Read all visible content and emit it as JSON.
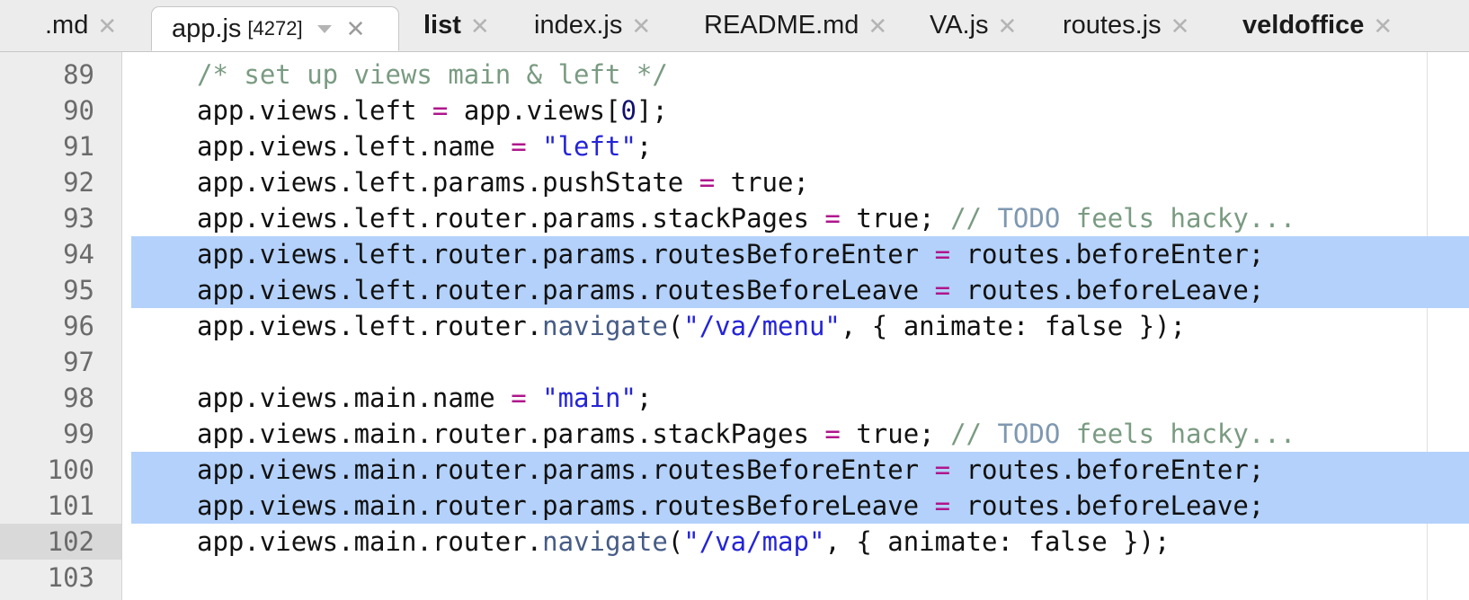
{
  "tabs": [
    {
      "label": ".md",
      "bold": false,
      "active": false,
      "close": "✕"
    },
    {
      "label": "app.js",
      "badge": "[4272]",
      "bold": false,
      "active": true,
      "close": "✕"
    },
    {
      "label": "list",
      "bold": true,
      "active": false,
      "close": "✕"
    },
    {
      "label": "index.js",
      "bold": false,
      "active": false,
      "close": "✕"
    },
    {
      "label": "README.md",
      "bold": false,
      "active": false,
      "close": "✕"
    },
    {
      "label": "VA.js",
      "bold": false,
      "active": false,
      "close": "✕"
    },
    {
      "label": "routes.js",
      "bold": false,
      "active": false,
      "close": "✕"
    },
    {
      "label": "veldoffice",
      "bold": true,
      "active": false,
      "close": "✕"
    }
  ],
  "editor": {
    "current_line": 102,
    "selected_lines": [
      94,
      95,
      100,
      101
    ],
    "colors": {
      "comment": "#7a9b82",
      "todo": "#7f98b1",
      "string": "#2424d8",
      "operator": "#b0158c",
      "number": "#11116e",
      "function": "#465c86",
      "selection": "#b3d1fa"
    },
    "lines": [
      {
        "num": "89",
        "tokens": [
          {
            "t": "comment",
            "v": "/* set up views main & left */"
          }
        ]
      },
      {
        "num": "90",
        "tokens": [
          {
            "t": "plain",
            "v": "app.views.left "
          },
          {
            "t": "op",
            "v": "="
          },
          {
            "t": "plain",
            "v": " app.views["
          },
          {
            "t": "number",
            "v": "0"
          },
          {
            "t": "plain",
            "v": "];"
          }
        ]
      },
      {
        "num": "91",
        "tokens": [
          {
            "t": "plain",
            "v": "app.views.left.name "
          },
          {
            "t": "op",
            "v": "="
          },
          {
            "t": "plain",
            "v": " "
          },
          {
            "t": "string",
            "v": "\"left\""
          },
          {
            "t": "plain",
            "v": ";"
          }
        ]
      },
      {
        "num": "92",
        "tokens": [
          {
            "t": "plain",
            "v": "app.views.left.params.pushState "
          },
          {
            "t": "op",
            "v": "="
          },
          {
            "t": "plain",
            "v": " true;"
          }
        ]
      },
      {
        "num": "93",
        "tokens": [
          {
            "t": "plain",
            "v": "app.views.left.router.params.stackPages "
          },
          {
            "t": "op",
            "v": "="
          },
          {
            "t": "plain",
            "v": " true; "
          },
          {
            "t": "comment",
            "v": "// "
          },
          {
            "t": "todo",
            "v": "TODO"
          },
          {
            "t": "comment",
            "v": " feels hacky..."
          }
        ]
      },
      {
        "num": "94",
        "tokens": [
          {
            "t": "plain",
            "v": "app.views.left.router.params.routesBeforeEnter "
          },
          {
            "t": "op",
            "v": "="
          },
          {
            "t": "plain",
            "v": " routes.beforeEnter;"
          }
        ]
      },
      {
        "num": "95",
        "tokens": [
          {
            "t": "plain",
            "v": "app.views.left.router.params.routesBeforeLeave "
          },
          {
            "t": "op",
            "v": "="
          },
          {
            "t": "plain",
            "v": " routes.beforeLeave;"
          }
        ]
      },
      {
        "num": "96",
        "tokens": [
          {
            "t": "plain",
            "v": "app.views.left.router."
          },
          {
            "t": "fn",
            "v": "navigate"
          },
          {
            "t": "plain",
            "v": "("
          },
          {
            "t": "string",
            "v": "\"/va/menu\""
          },
          {
            "t": "plain",
            "v": ", { animate: false });"
          }
        ]
      },
      {
        "num": "97",
        "tokens": []
      },
      {
        "num": "98",
        "tokens": [
          {
            "t": "plain",
            "v": "app.views.main.name "
          },
          {
            "t": "op",
            "v": "="
          },
          {
            "t": "plain",
            "v": " "
          },
          {
            "t": "string",
            "v": "\"main\""
          },
          {
            "t": "plain",
            "v": ";"
          }
        ]
      },
      {
        "num": "99",
        "tokens": [
          {
            "t": "plain",
            "v": "app.views.main.router.params.stackPages "
          },
          {
            "t": "op",
            "v": "="
          },
          {
            "t": "plain",
            "v": " true; "
          },
          {
            "t": "comment",
            "v": "// "
          },
          {
            "t": "todo",
            "v": "TODO"
          },
          {
            "t": "comment",
            "v": " feels hacky..."
          }
        ]
      },
      {
        "num": "100",
        "tokens": [
          {
            "t": "plain",
            "v": "app.views.main.router.params.routesBeforeEnter "
          },
          {
            "t": "op",
            "v": "="
          },
          {
            "t": "plain",
            "v": " routes.beforeEnter;"
          }
        ]
      },
      {
        "num": "101",
        "tokens": [
          {
            "t": "plain",
            "v": "app.views.main.router.params.routesBeforeLeave "
          },
          {
            "t": "op",
            "v": "="
          },
          {
            "t": "plain",
            "v": " routes.beforeLeave;"
          }
        ]
      },
      {
        "num": "102",
        "tokens": [
          {
            "t": "plain",
            "v": "app.views.main.router."
          },
          {
            "t": "fn",
            "v": "navigate"
          },
          {
            "t": "plain",
            "v": "("
          },
          {
            "t": "string",
            "v": "\"/va/map\""
          },
          {
            "t": "plain",
            "v": ", { animate: false });"
          }
        ]
      },
      {
        "num": "103",
        "tokens": []
      }
    ]
  }
}
